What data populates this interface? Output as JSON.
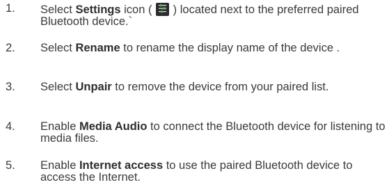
{
  "steps": [
    {
      "number": "1.",
      "before": "Select ",
      "bold": "Settings",
      "middle": " icon ( ",
      "icon": "settings-sliders-icon",
      "after": " ) located next to the preferred paired Bluetooth device.`"
    },
    {
      "number": "2.",
      "before": "Select ",
      "bold": "Rename",
      "after": " to rename the display name of the device ."
    },
    {
      "number": "3.",
      "before": "Select ",
      "bold": "Unpair",
      "after": " to remove the device from your paired list."
    },
    {
      "number": "4.",
      "before": "Enable ",
      "bold": "Media Audio",
      "after": " to connect the Bluetooth device for listening to media files."
    },
    {
      "number": "5.",
      "before": "Enable ",
      "bold": "Internet access",
      "after": " to use the paired Bluetooth device to access the Internet."
    }
  ],
  "colors": {
    "text": "#3a3a3a",
    "icon_background": "#2c2c2c",
    "icon_accent": "#4caf50"
  }
}
